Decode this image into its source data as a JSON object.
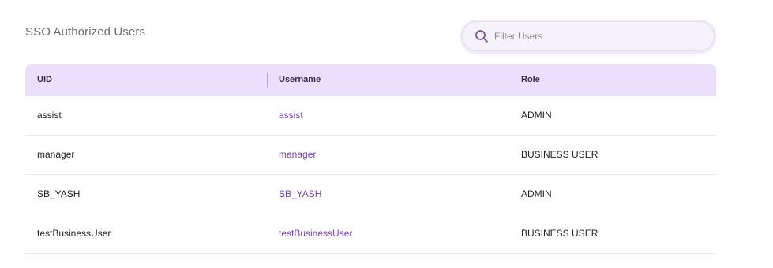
{
  "page": {
    "title": "SSO Authorized Users"
  },
  "search": {
    "placeholder": "Filter Users",
    "value": ""
  },
  "table": {
    "columns": {
      "uid": "UID",
      "username": "Username",
      "role": "Role"
    },
    "rows": [
      {
        "uid": "assist",
        "username": "assist",
        "role": "ADMIN"
      },
      {
        "uid": "manager",
        "username": "manager",
        "role": "BUSINESS USER"
      },
      {
        "uid": "SB_YASH",
        "username": "SB_YASH",
        "role": "ADMIN"
      },
      {
        "uid": "testBusinessUser",
        "username": "testBusinessUser",
        "role": "BUSINESS USER"
      }
    ]
  },
  "colors": {
    "header_bg": "#ecdffb",
    "link": "#7b3fb8",
    "search_icon": "#7b4fa6"
  },
  "icons": {
    "search": "search-icon"
  }
}
